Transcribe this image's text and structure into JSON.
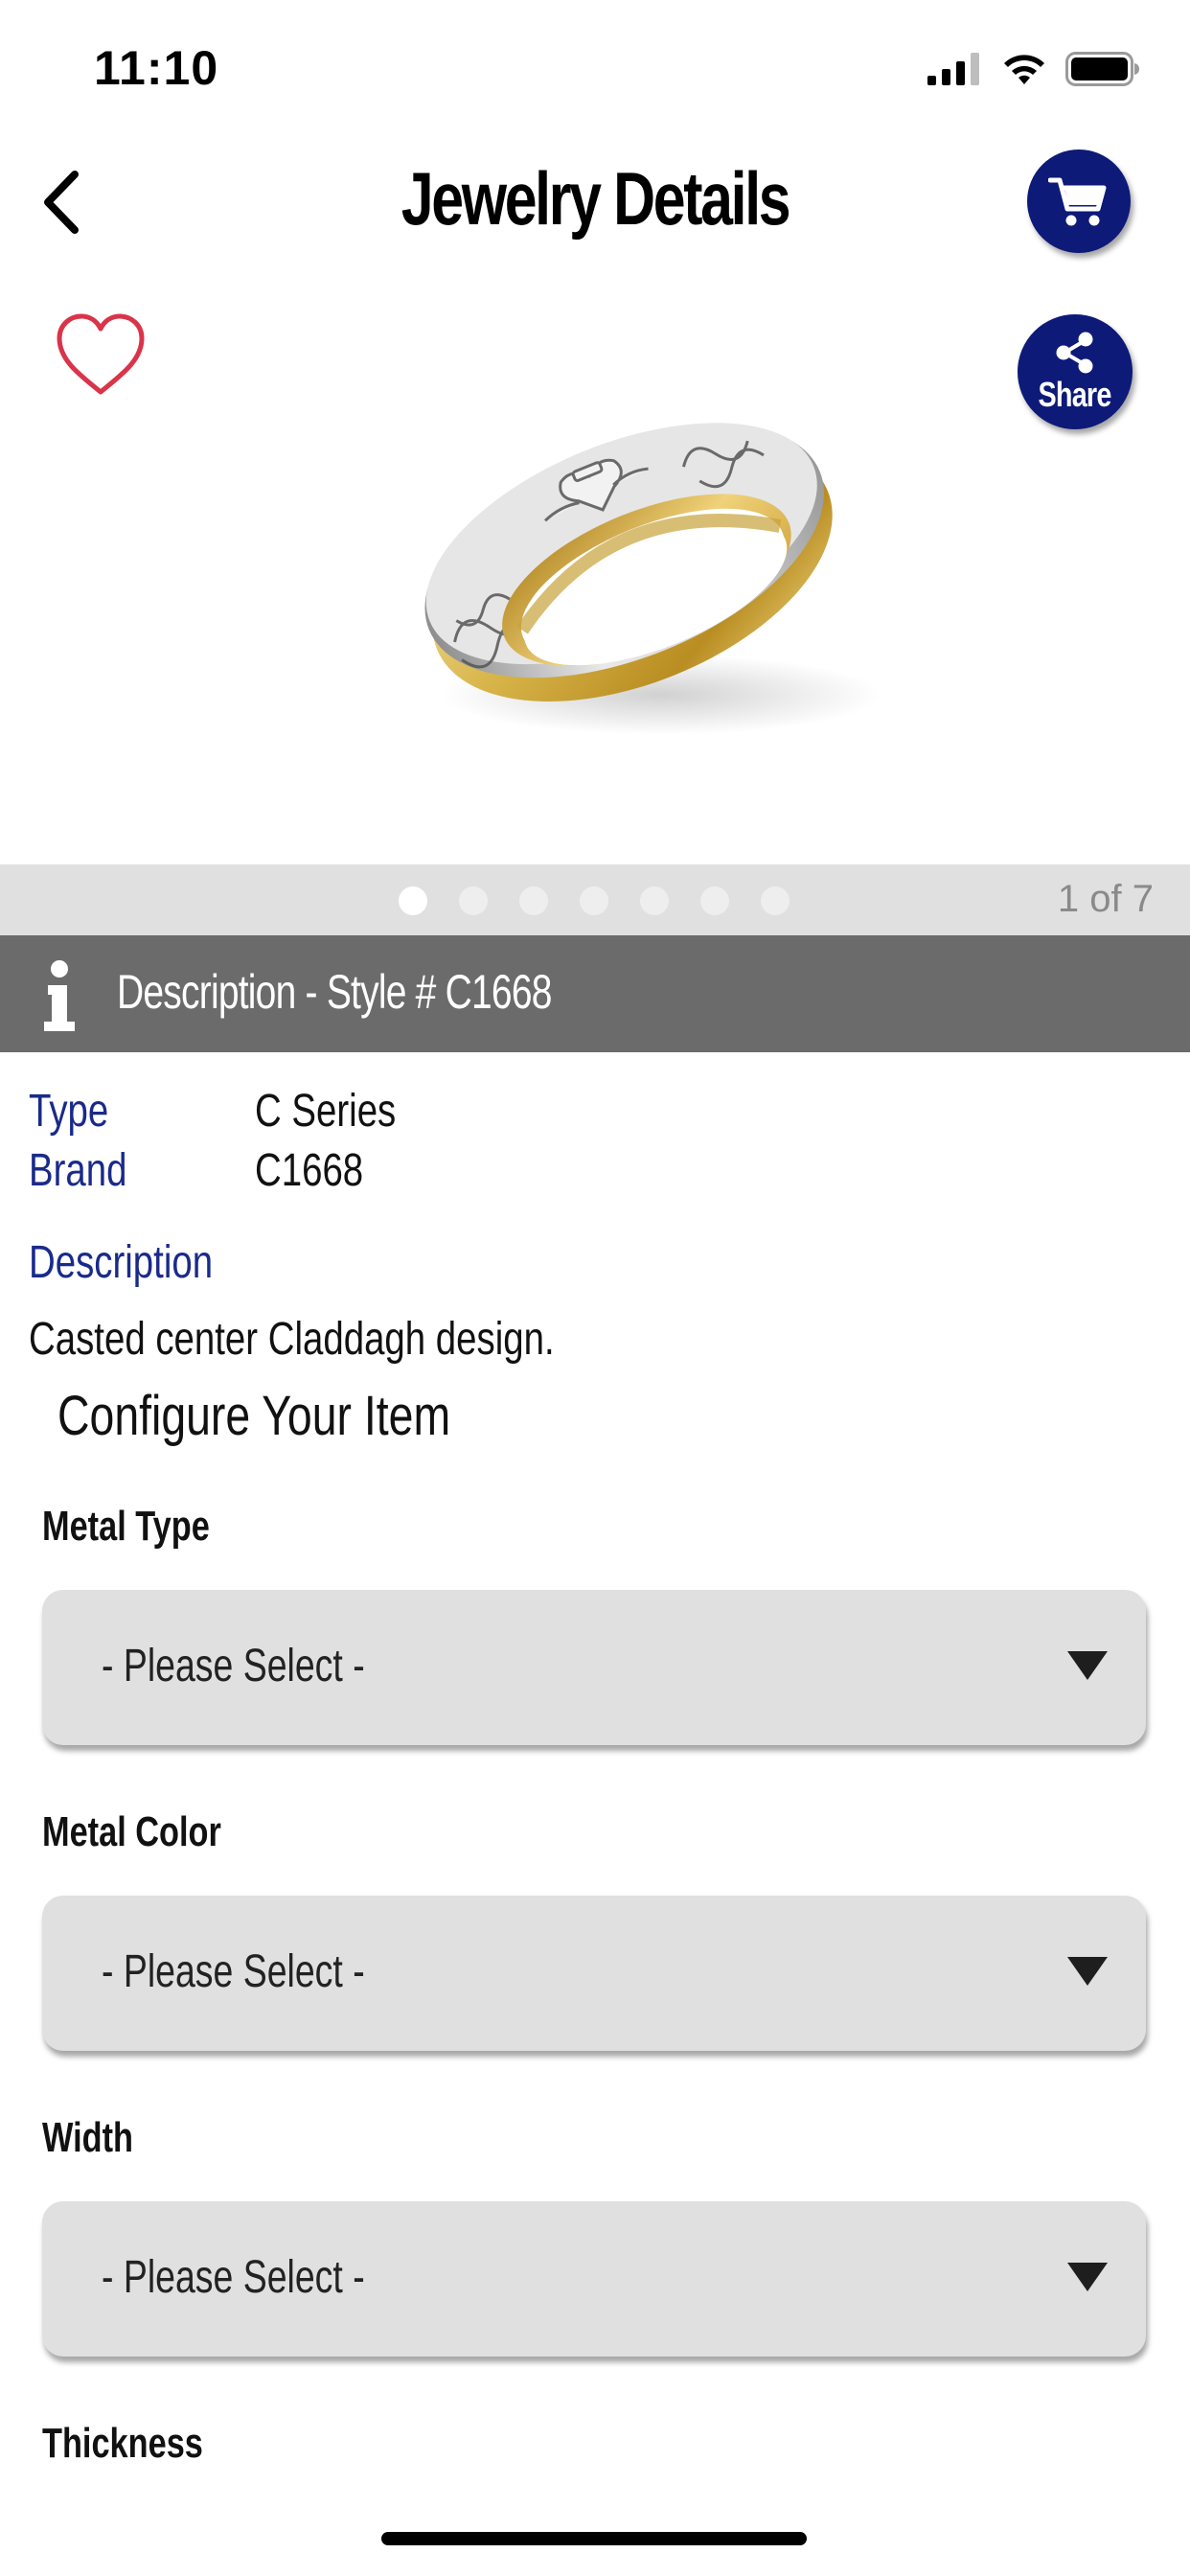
{
  "status_bar": {
    "time": "11:10"
  },
  "header": {
    "title": "Jewelry Details",
    "back_icon": "chevron-left-icon",
    "cart_icon": "cart-icon"
  },
  "product": {
    "favorite_icon": "heart-outline-icon",
    "share_label": "Share",
    "image_alt": "gold and white gold Claddagh ring"
  },
  "pager": {
    "total": 7,
    "current": 1,
    "count_text": "1 of 7"
  },
  "description_header": {
    "icon": "info-icon",
    "text": "Description - Style # C1668"
  },
  "details": {
    "type_label": "Type",
    "type_value": "C Series",
    "brand_label": "Brand",
    "brand_value": "C1668",
    "description_label": "Description",
    "description_text": "Casted center Claddagh design."
  },
  "configure": {
    "heading": "Configure Your Item",
    "fields": [
      {
        "label": "Metal Type",
        "value": "- Please Select -"
      },
      {
        "label": "Metal Color",
        "value": "- Please Select -"
      },
      {
        "label": "Width",
        "value": "- Please Select -"
      },
      {
        "label": "Thickness"
      }
    ]
  },
  "colors": {
    "brand_navy": "#0d1a78",
    "label_blue": "#1a2a8a",
    "header_gray": "#6b6b6b",
    "favorite_red": "#d9344a"
  }
}
